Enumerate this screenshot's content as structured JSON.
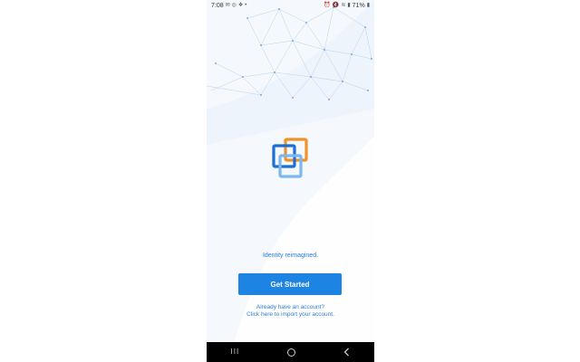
{
  "status_bar": {
    "time": "7:08",
    "battery": "71%",
    "left_icons": [
      "mail-icon",
      "instagram-icon",
      "paw-icon",
      "dot-icon"
    ],
    "right_icons": [
      "alarm-icon",
      "mute-icon",
      "wifi-icon",
      "signal-icon",
      "battery-icon"
    ]
  },
  "app": {
    "tagline": "Identity reimagined.",
    "primary_button": "Get Started",
    "import_line1": "Already have an account?",
    "import_line2": "Click here to import your account.",
    "colors": {
      "accent_blue": "#1e84e4",
      "logo_orange": "#f0922a",
      "logo_dark_blue": "#1d6fd6",
      "logo_light_blue": "#7ab8ef",
      "background": "#f5f8fc"
    }
  },
  "nav_bar": {
    "recent": "III",
    "back": "<"
  }
}
